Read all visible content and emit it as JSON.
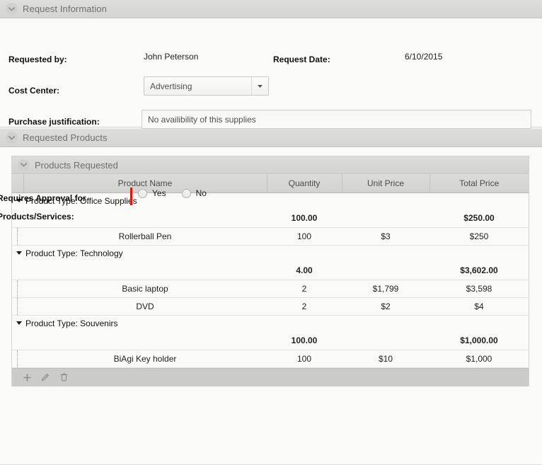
{
  "sections": {
    "request_info": {
      "title": "Request Information",
      "chevron_icon": "chevron-down-icon",
      "requested_by_label": "Requested by:",
      "requested_by_value": "John Peterson",
      "request_date_label": "Request Date:",
      "request_date_value": "6/10/2015",
      "cost_center_label": "Cost Center:",
      "cost_center_value": "Advertising",
      "cost_center_arrow_icon": "chevron-down-icon",
      "justification_label": "Purchase justification:",
      "justification_value": "No availibility of this supplies"
    },
    "requested_products": {
      "title": "Requested Products",
      "chevron_icon": "chevron-down-icon",
      "inner_title": "Products Requested",
      "inner_chevron_icon": "chevron-down-icon"
    }
  },
  "grid": {
    "columns": [
      "",
      "Product Name",
      "Quantity",
      "Unit Price",
      "Total Price"
    ],
    "groups": [
      {
        "label": "Product Type: Office Supplies",
        "summary": {
          "quantity": "100.00",
          "unit_price": "",
          "total_price": "$250.00"
        },
        "rows": [
          {
            "name": "Rollerball Pen",
            "quantity": "100",
            "unit_price": "$3",
            "total_price": "$250"
          }
        ]
      },
      {
        "label": "Product Type: Technology",
        "summary": {
          "quantity": "4.00",
          "unit_price": "",
          "total_price": "$3,602.00"
        },
        "rows": [
          {
            "name": "Basic laptop",
            "quantity": "2",
            "unit_price": "$1,799",
            "total_price": "$3,598"
          },
          {
            "name": "DVD",
            "quantity": "2",
            "unit_price": "$2",
            "total_price": "$4"
          }
        ]
      },
      {
        "label": "Product Type: Souvenirs",
        "summary": {
          "quantity": "100.00",
          "unit_price": "",
          "total_price": "$1,000.00"
        },
        "rows": [
          {
            "name": "BiAgi Key holder",
            "quantity": "100",
            "unit_price": "$10",
            "total_price": "$1,000"
          }
        ]
      }
    ],
    "toolbar": {
      "add_icon": "plus-icon",
      "edit_icon": "pencil-icon",
      "delete_icon": "trash-icon"
    }
  },
  "approval": {
    "label_line1": "Requires Approval for",
    "label_line2": "Products/Services:",
    "required_indicator_color": "#e8120c",
    "options": [
      {
        "label": "Yes",
        "selected": false
      },
      {
        "label": "No",
        "selected": false
      }
    ]
  }
}
